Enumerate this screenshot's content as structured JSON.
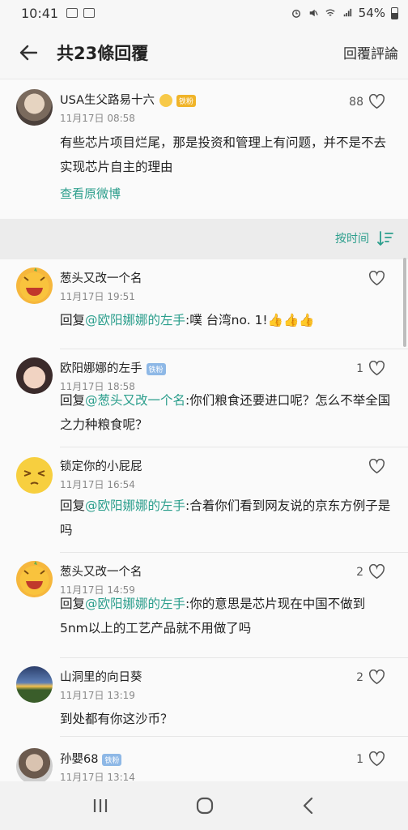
{
  "status_bar": {
    "time": "10:41",
    "battery": "54%"
  },
  "header": {
    "title": "共23條回覆",
    "reply_comment": "回覆評論"
  },
  "original": {
    "user": "USA生父路易十六",
    "badge": "铁粉",
    "time": "11月17日 08:58",
    "likes": "88",
    "text": "有些芯片项目烂尾，那是投资和管理上有问题，并不是不去实现芯片自主的理由",
    "view_original": "查看原微博"
  },
  "sort": {
    "label": "按时间"
  },
  "comments": [
    {
      "user": "葱头又改一个名",
      "time": "11月17日 19:51",
      "likes": "",
      "prefix": "回复",
      "mention": "@欧阳娜娜的左手",
      "text": ":噗  台湾no. 1!👍👍👍"
    },
    {
      "user": "欧阳娜娜的左手",
      "badge": "铁粉",
      "time": "11月17日 18:58",
      "likes": "1",
      "prefix": "回复",
      "mention": "@葱头又改一个名",
      "text": ":你们粮食还要进口呢？怎么不举全国之力种粮食呢？"
    },
    {
      "user": "锁定你的小屁屁",
      "time": "11月17日 16:54",
      "likes": "",
      "prefix": "回复",
      "mention": "@欧阳娜娜的左手",
      "text": ":合着你们看到网友说的京东方例子是吗"
    },
    {
      "user": "葱头又改一个名",
      "time": "11月17日 14:59",
      "likes": "2",
      "prefix": "回复",
      "mention": "@欧阳娜娜的左手",
      "text": ":你的意思是芯片现在中国不做到5nm以上的工艺产品就不用做了吗"
    },
    {
      "user": "山洞里的向日葵",
      "time": "11月17日 13:19",
      "likes": "2",
      "prefix": "",
      "mention": "",
      "text": "到处都有你这沙币？"
    },
    {
      "user": "孙嬰68",
      "badge": "铁粉",
      "time": "11月17日 13:14",
      "likes": "1",
      "prefix": "",
      "mention": "",
      "text": ""
    }
  ],
  "colors": {
    "accent": "#2b9e8c",
    "divider": "#ececec"
  }
}
